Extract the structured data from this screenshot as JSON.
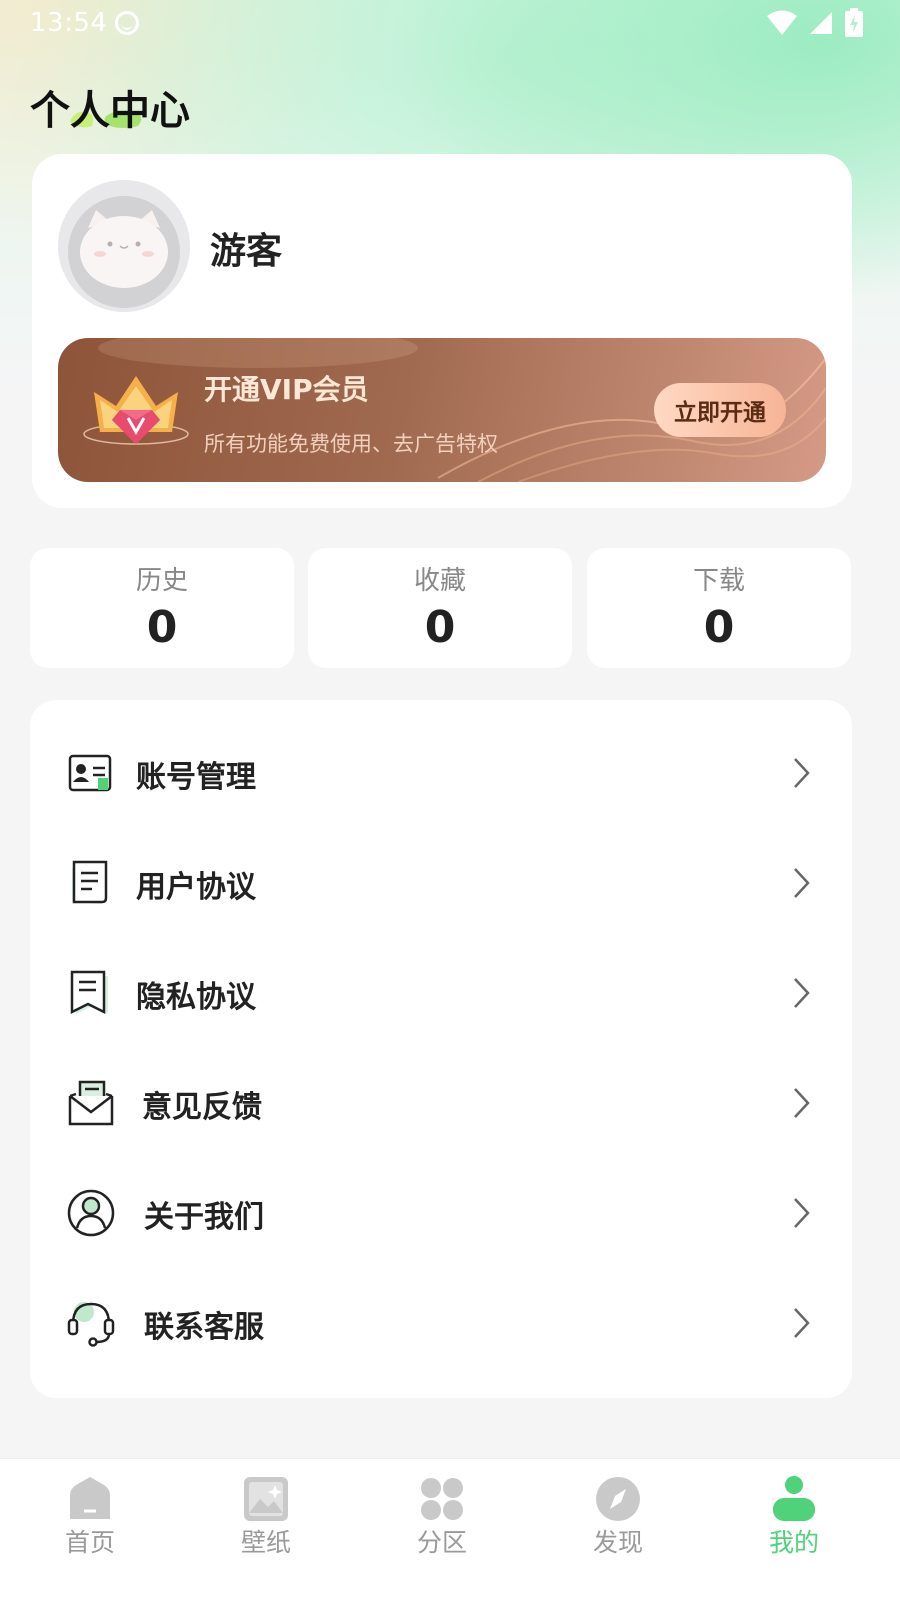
{
  "status_bar": {
    "time": "13:54"
  },
  "page": {
    "title": "个人中心"
  },
  "profile": {
    "username": "游客"
  },
  "vip": {
    "title": "开通VIP会员",
    "subtitle": "所有功能免费使用、去广告特权",
    "button_label": "立即开通"
  },
  "stats": [
    {
      "label": "历史",
      "value": "0"
    },
    {
      "label": "收藏",
      "value": "0"
    },
    {
      "label": "下载",
      "value": "0"
    }
  ],
  "menu": [
    {
      "label": "账号管理",
      "icon": "id-card-icon"
    },
    {
      "label": "用户协议",
      "icon": "document-icon"
    },
    {
      "label": "隐私协议",
      "icon": "bookmark-document-icon"
    },
    {
      "label": "意见反馈",
      "icon": "mail-icon"
    },
    {
      "label": "关于我们",
      "icon": "user-circle-icon"
    },
    {
      "label": "联系客服",
      "icon": "headset-icon"
    }
  ],
  "tabbar": [
    {
      "label": "首页",
      "icon": "home-icon",
      "active": false
    },
    {
      "label": "壁纸",
      "icon": "image-icon",
      "active": false
    },
    {
      "label": "分区",
      "icon": "grid-icon",
      "active": false
    },
    {
      "label": "发现",
      "icon": "compass-icon",
      "active": false
    },
    {
      "label": "我的",
      "icon": "person-icon",
      "active": true
    }
  ],
  "colors": {
    "accent": "#4fd27a",
    "vip_gradient_start": "#8e5439",
    "vip_gradient_end": "#d49a86",
    "vip_button": "#f7b496"
  }
}
